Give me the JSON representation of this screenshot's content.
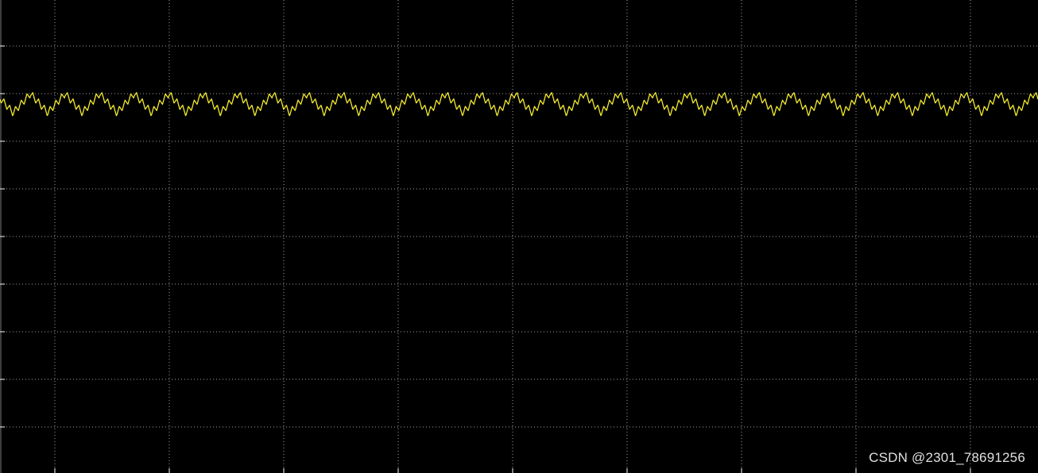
{
  "colors": {
    "background": "#000000",
    "grid": "#d9d9d9",
    "trace": "#f2ea2f",
    "watermark": "#ffffff"
  },
  "watermark": "CSDN @2301_78691256",
  "chart_data": {
    "type": "line",
    "grid": true,
    "grid_style": "dotted",
    "grid_divisions": {
      "x": 9,
      "y": 10
    },
    "series": [
      {
        "waveform": "triangle ripple with superimposed high-frequency ripple",
        "cycles_visible": 30,
        "high_frequency_cycles_per_main_cycle": 6,
        "level_divisions_below_top": 1.0,
        "peak_to_peak_divisions": 0.55
      }
    ]
  }
}
